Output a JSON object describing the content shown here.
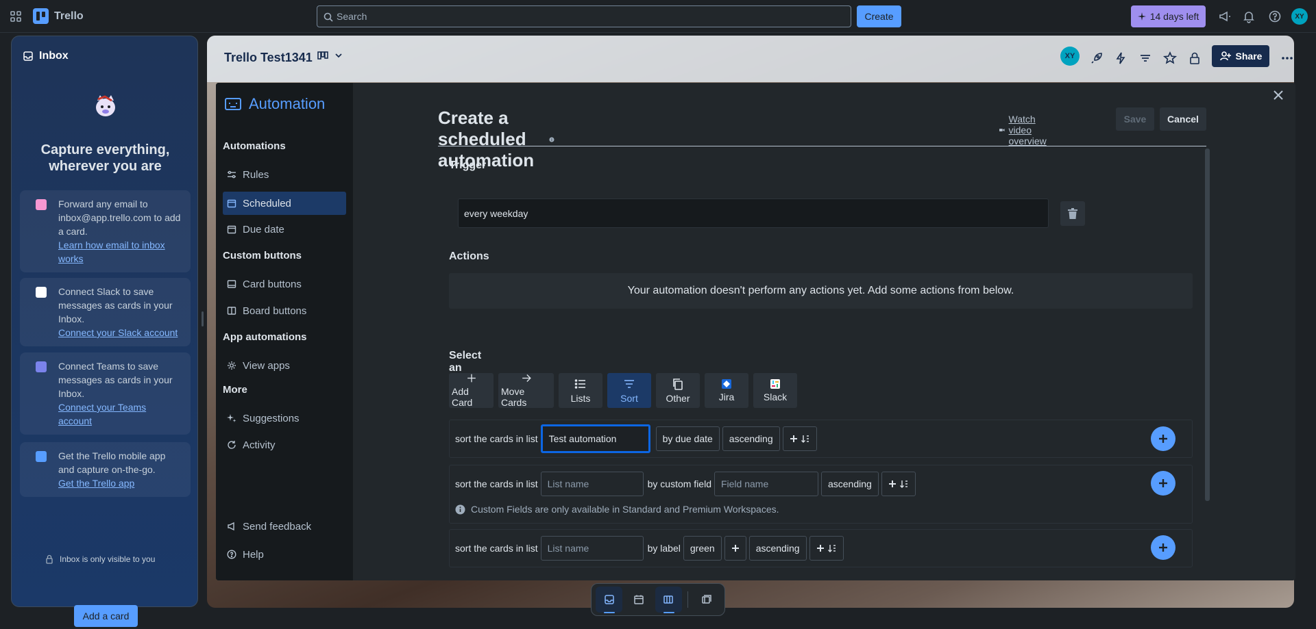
{
  "topbar": {
    "app_name": "Trello",
    "search_placeholder": "Search",
    "create_label": "Create",
    "trial_label": "14 days left",
    "avatar_initials": "XY"
  },
  "inbox": {
    "title": "Inbox",
    "headline": "Capture everything, wherever you are",
    "cards": [
      {
        "text": "Forward any email to inbox@app.trello.com to add a card.",
        "link": "Learn how email to inbox works"
      },
      {
        "text": "Connect Slack to save messages as cards in your Inbox.",
        "link": "Connect your Slack account"
      },
      {
        "text": "Connect Teams to save messages as cards in your Inbox.",
        "link": "Connect your Teams account"
      },
      {
        "text": "Get the Trello mobile app and capture on-the-go.",
        "link": "Get the Trello app"
      }
    ],
    "visibility_note": "Inbox is only visible to you",
    "add_card_label": "Add a card"
  },
  "board": {
    "title": "Trello Test1341",
    "member_initials": "XY",
    "share_label": "Share"
  },
  "automation": {
    "brand": "Automation",
    "menu": {
      "automations_heading": "Automations",
      "rules": "Rules",
      "scheduled": "Scheduled",
      "due_date": "Due date",
      "custom_buttons_heading": "Custom buttons",
      "card_buttons": "Card buttons",
      "board_buttons": "Board buttons",
      "app_automations_heading": "App automations",
      "view_apps": "View apps",
      "more_heading": "More",
      "suggestions": "Suggestions",
      "activity": "Activity",
      "send_feedback": "Send feedback",
      "help": "Help"
    },
    "page_title": "Create a scheduled automation",
    "watch_video": "Watch video overview",
    "save_label": "Save",
    "cancel_label": "Cancel",
    "trigger_heading": "Trigger",
    "trigger_value": "every weekday",
    "actions_heading": "Actions",
    "actions_empty": "Your automation doesn't perform any actions yet. Add some actions from below.",
    "select_action_heading": "Select an Action",
    "action_tabs": [
      "Add Card",
      "Move Cards",
      "Lists",
      "Sort",
      "Other",
      "Jira",
      "Slack"
    ],
    "rows": {
      "row1": {
        "prefix": "sort the cards in list",
        "list_value": "Test automation",
        "by": "by due date",
        "order": "ascending"
      },
      "row2": {
        "prefix": "sort the cards in list",
        "list_placeholder": "List name",
        "by": "by custom field",
        "field_placeholder": "Field name",
        "order": "ascending",
        "note": "Custom Fields are only available in Standard and Premium Workspaces."
      },
      "row3": {
        "prefix": "sort the cards in list",
        "list_placeholder": "List name",
        "by": "by label",
        "label": "green",
        "order": "ascending"
      }
    }
  },
  "colors": {
    "accent": "#579dff",
    "trial": "#9f8fef",
    "selected": "#1c3a67",
    "focus_ring": "#0c66e4"
  }
}
